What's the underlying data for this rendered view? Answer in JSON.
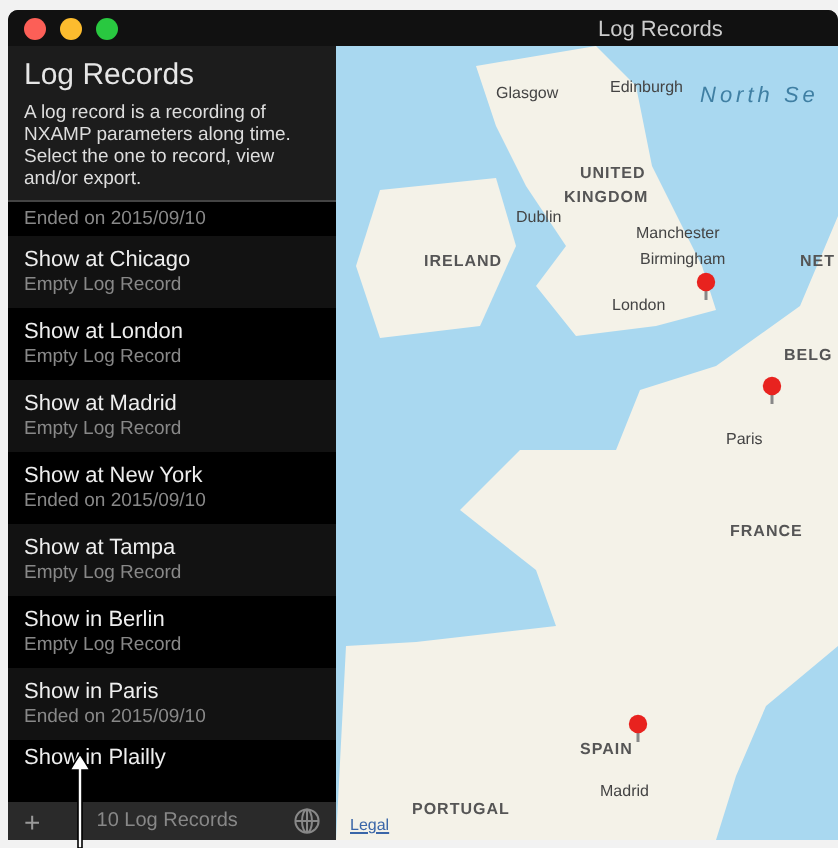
{
  "window": {
    "title": "Log Records"
  },
  "sidebar": {
    "title": "Log Records",
    "description": "A log record is a recording of NXAMP parameters along time. Select the one to record, view and/or export.",
    "records": [
      {
        "detail": "Ended on 2015/09/10",
        "selected": false
      },
      {
        "name": "Show at Chicago",
        "detail": "Empty Log Record",
        "selected": false
      },
      {
        "name": "Show at London",
        "detail": "Empty Log Record",
        "selected": false
      },
      {
        "name": "Show at Madrid",
        "detail": "Empty Log Record",
        "selected": false
      },
      {
        "name": "Show at New York",
        "detail": "Ended on 2015/09/10",
        "selected": false
      },
      {
        "name": "Show at Tampa",
        "detail": "Empty Log Record",
        "selected": false
      },
      {
        "name": "Show in Berlin",
        "detail": "Empty Log Record",
        "selected": false
      },
      {
        "name": "Show in Paris",
        "detail": "Ended on 2015/09/10",
        "selected": false
      },
      {
        "name": "Show in Plailly",
        "selected": false
      }
    ],
    "add_button": "+",
    "count": "10 Log Records"
  },
  "map": {
    "labels": [
      {
        "text": "Glasgow",
        "kind": "city"
      },
      {
        "text": "Edinburgh",
        "kind": "city"
      },
      {
        "text": "North Se",
        "kind": "sea"
      },
      {
        "text": "UNITED",
        "kind": "country"
      },
      {
        "text": "KINGDOM",
        "kind": "country"
      },
      {
        "text": "Dublin",
        "kind": "city"
      },
      {
        "text": "IRELAND",
        "kind": "country"
      },
      {
        "text": "Manchester",
        "kind": "city"
      },
      {
        "text": "Birmingham",
        "kind": "city"
      },
      {
        "text": "London",
        "kind": "city"
      },
      {
        "text": "NET",
        "kind": "country"
      },
      {
        "text": "BELG",
        "kind": "country"
      },
      {
        "text": "Paris",
        "kind": "city"
      },
      {
        "text": "FRANCE",
        "kind": "country"
      },
      {
        "text": "SPAIN",
        "kind": "country"
      },
      {
        "text": "Madrid",
        "kind": "city"
      },
      {
        "text": "PORTUGAL",
        "kind": "country"
      }
    ],
    "legal": "Legal"
  }
}
